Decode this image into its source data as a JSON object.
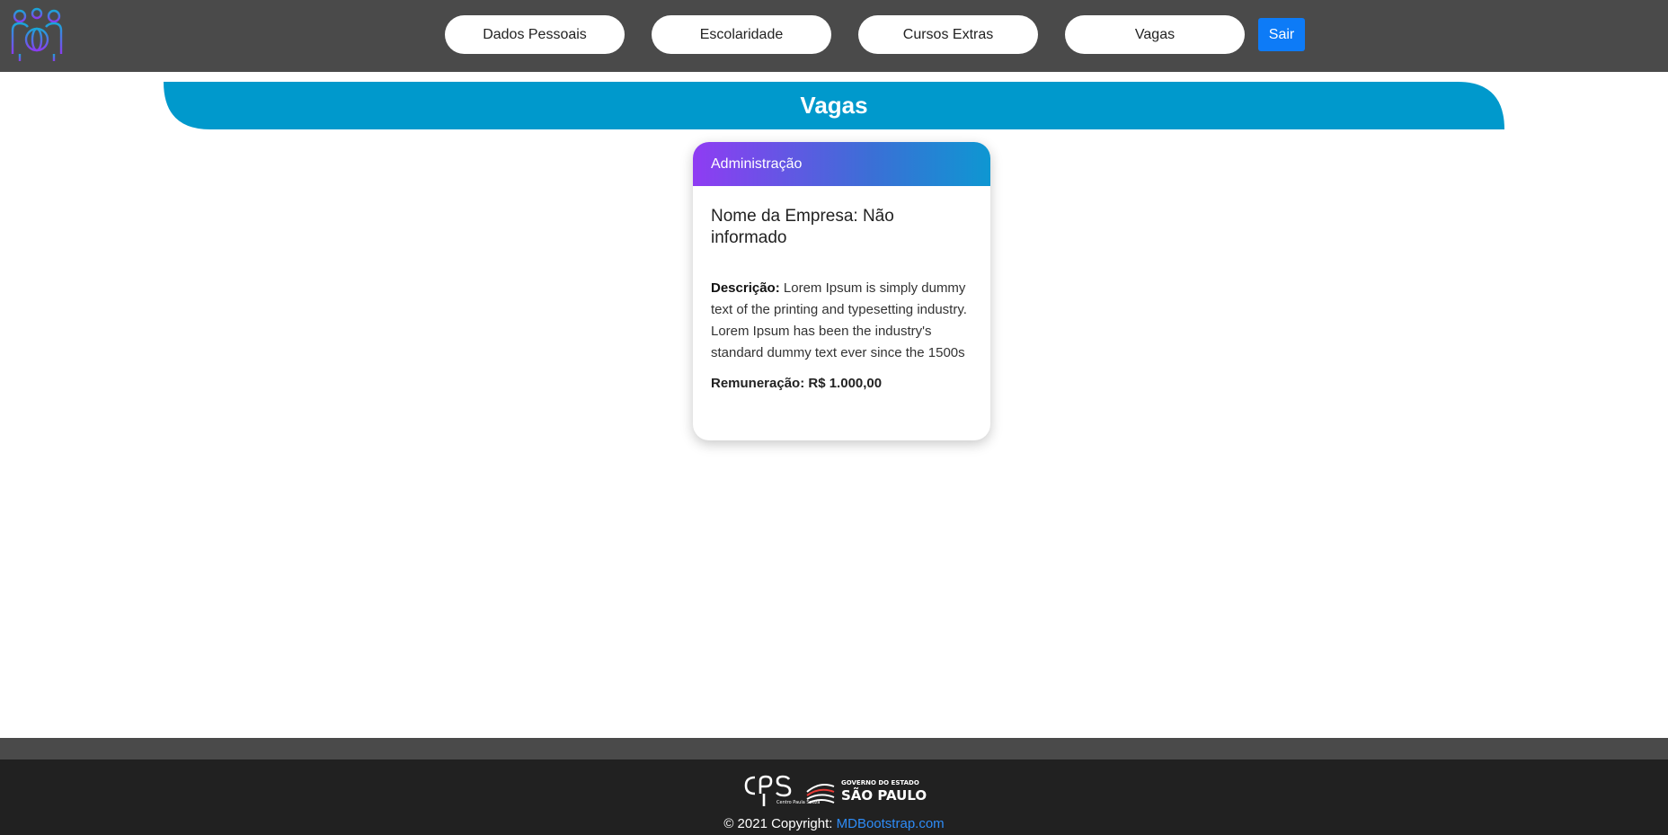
{
  "navbar": {
    "logo_icon": "people-globe-icon",
    "items": [
      {
        "label": "Dados Pessoais"
      },
      {
        "label": "Escolaridade"
      },
      {
        "label": "Cursos Extras"
      },
      {
        "label": "Vagas"
      }
    ],
    "logout_label": "Sair",
    "colors": {
      "bar": "#4a4a4a",
      "logout": "#0d7bf7"
    }
  },
  "section": {
    "title": "Vagas",
    "color": "#0099cc"
  },
  "job_card": {
    "category": "Administração",
    "company": "Nome da Empresa: Não informado",
    "description_label": "Descrição:",
    "description": " Lorem Ipsum is simply dummy text of the printing and typesetting industry. Lorem Ipsum has been the industry's standard dummy text ever since the 1500s",
    "salary": "Remuneração: R$ 1.000,00",
    "header_gradient": [
      "#8f3cf3",
      "#0e97d2"
    ]
  },
  "footer": {
    "logo_cps_text": "cps",
    "logo_cps_sub": "Centro Paula Souza",
    "logo_sp_top": "GOVERNO DO ESTADO",
    "logo_sp_main": "SÃO PAULO",
    "copyright_prefix": "© 2021 Copyright: ",
    "copyright_link": "MDBootstrap.com"
  }
}
